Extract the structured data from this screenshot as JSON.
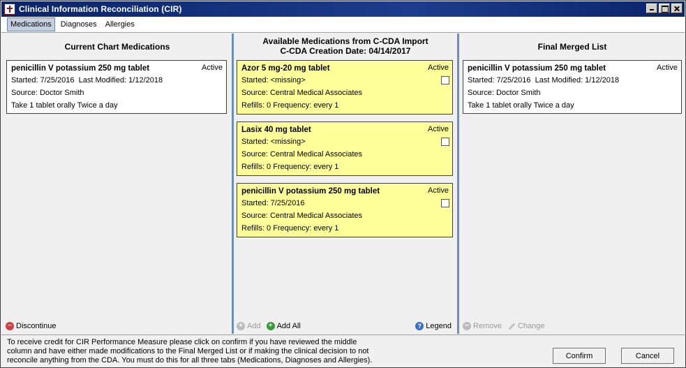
{
  "window": {
    "title": "Clinical Information Reconciliation (CIR)"
  },
  "tabs": [
    {
      "label": "Medications",
      "active": true
    },
    {
      "label": "Diagnoses",
      "active": false
    },
    {
      "label": "Allergies",
      "active": false
    }
  ],
  "left": {
    "header": "Current Chart Medications",
    "cards": [
      {
        "name": "penicillin V potassium 250 mg tablet",
        "status": "Active",
        "started": "Started: 7/25/2016",
        "modified": "Last Modified: 1/12/2018",
        "source": "Source: Doctor Smith",
        "instructions": "Take 1 tablet orally Twice a day"
      }
    ],
    "discontinue_label": "Discontinue"
  },
  "middle": {
    "header_line1": "Available Medications from C-CDA Import",
    "header_line2": "C-CDA Creation Date: 04/14/2017",
    "cards": [
      {
        "name": "Azor 5 mg-20 mg tablet",
        "status": "Active",
        "started": "Started: <missing>",
        "source": "Source: Central Medical Associates",
        "refills": "Refills: 0 Frequency: every 1",
        "checked": false
      },
      {
        "name": "Lasix 40 mg tablet",
        "status": "Active",
        "started": "Started: <missing>",
        "source": "Source: Central Medical Associates",
        "refills": "Refills: 0 Frequency: every 1",
        "checked": false
      },
      {
        "name": "penicillin V potassium 250 mg tablet",
        "status": "Active",
        "started": "Started: 7/25/2016",
        "source": "Source: Central Medical Associates",
        "refills": "Refills: 0 Frequency: every 1",
        "checked": false
      }
    ],
    "add_label": "Add",
    "add_all_label": "Add All",
    "legend_label": "Legend"
  },
  "right": {
    "header": "Final Merged List",
    "cards": [
      {
        "name": "penicillin V potassium 250 mg tablet",
        "status": "Active",
        "started": "Started: 7/25/2016",
        "modified": "Last Modified: 1/12/2018",
        "source": "Source: Doctor Smith",
        "instructions": "Take 1 tablet orally Twice a day"
      }
    ],
    "remove_label": "Remove",
    "change_label": "Change"
  },
  "footer": {
    "line1": "To receive credit for CIR Performance Measure please click on confirm if you have reviewed the middle",
    "line2": "column and have either made modifications to the Final Merged List or if making the clinical decision to not",
    "line3": "reconcile anything from the CDA. You must do this for all three tabs (Medications, Diagnoses and Allergies).",
    "confirm_label": "Confirm",
    "cancel_label": "Cancel"
  },
  "colors": {
    "title_bar": "#0a246a",
    "card_yellow": "#ffff99",
    "separator": "#6b8fb8",
    "tab_active": "#c5cfe0"
  },
  "icons": {
    "app": "medical-cross-icon",
    "discontinue": "minus-circle-icon",
    "add": "plus-circle-icon",
    "legend": "help-circle-icon",
    "remove": "minus-circle-icon",
    "change": "pencil-icon"
  }
}
